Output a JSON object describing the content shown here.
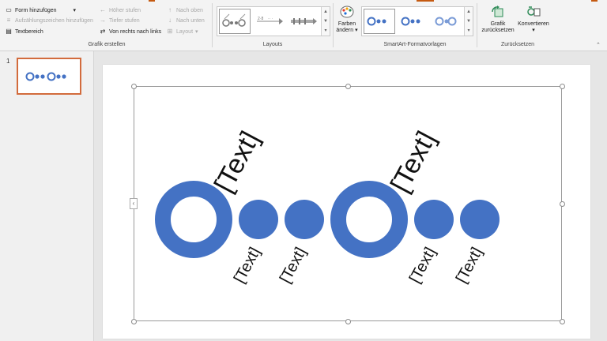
{
  "create_graphic": {
    "add_shape": "Form hinzufügen",
    "add_bullet": "Aufzählungszeichen hinzufügen",
    "text_pane": "Textbereich",
    "promote": "Höher stufen",
    "demote": "Tiefer stufen",
    "right_to_left": "Von rechts nach links",
    "move_up": "Nach oben",
    "move_down": "Nach unten",
    "layout": "Layout",
    "group_label": "Grafik erstellen"
  },
  "layouts": {
    "group_label": "Layouts"
  },
  "smartart_styles": {
    "change_colors_line1": "Farben",
    "change_colors_line2": "ändern",
    "group_label": "SmartArt-Formatvorlagen"
  },
  "reset": {
    "reset_graphic_line1": "Grafik",
    "reset_graphic_line2": "zurücksetzen",
    "convert": "Konvertieren",
    "group_label": "Zurücksetzen"
  },
  "slide_panel": {
    "slide_number": "1"
  },
  "smartart": {
    "top_labels": [
      "[Text]",
      "[Text]"
    ],
    "bottom_labels": [
      "[Text]",
      "[Text]",
      "[Text]",
      "[Text]"
    ]
  },
  "colors": {
    "accent": "#4472c4",
    "selection_border": "#d26b3c",
    "ribbon_top": "#c55a11"
  }
}
